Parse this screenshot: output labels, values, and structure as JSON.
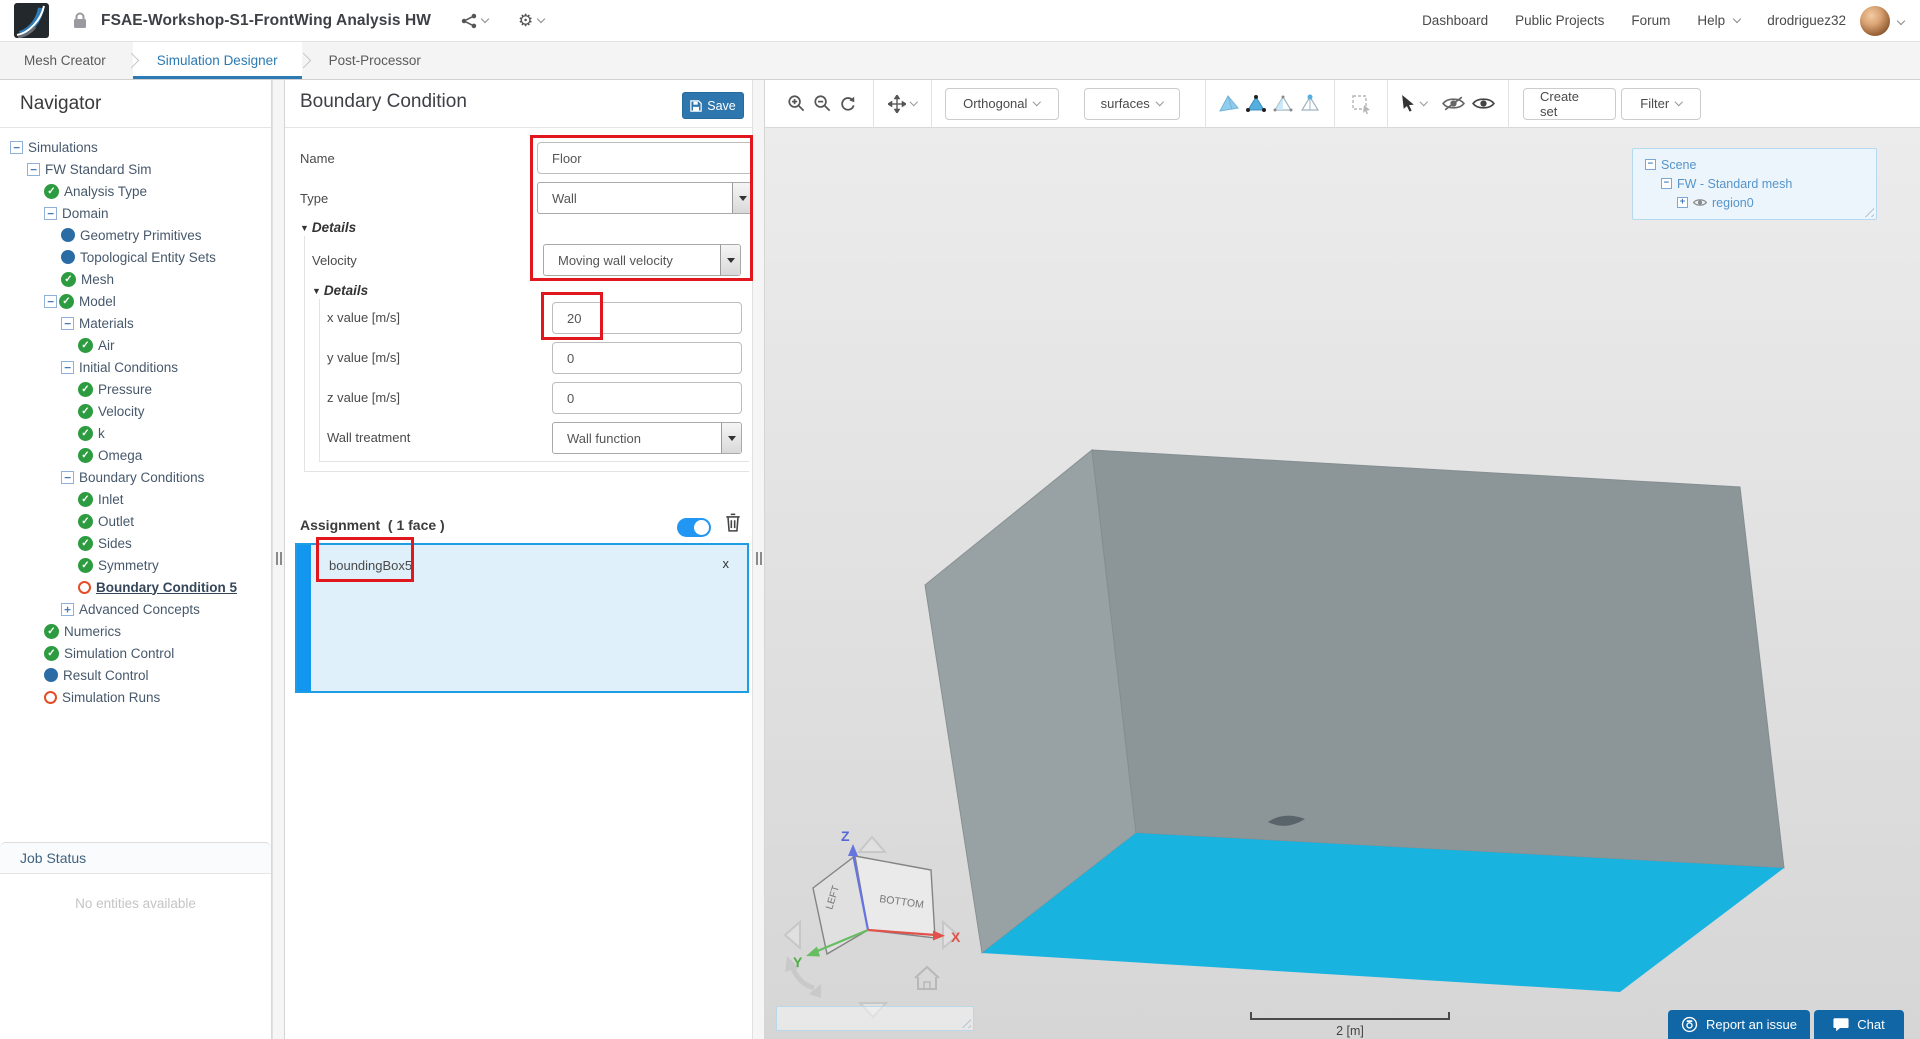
{
  "colors": {
    "accent_blue": "#2e77ae",
    "selection_blue": "#1e9de5",
    "assignment_stripe_blue": "#1296f0",
    "highlight_cyan": "#18b3df",
    "annotation_red": "#e0181e",
    "status_green": "#2d9b3f",
    "status_dot_blue": "#2c6ca5",
    "status_ring_orange": "#e44d26"
  },
  "topbar": {
    "title": "FSAE-Workshop-S1-FrontWing Analysis HW",
    "links": [
      "Dashboard",
      "Public Projects",
      "Forum",
      "Help",
      "drodriguez32"
    ]
  },
  "tabs": [
    {
      "label": "Mesh Creator",
      "active": false
    },
    {
      "label": "Simulation Designer",
      "active": true
    },
    {
      "label": "Post-Processor",
      "active": false
    }
  ],
  "navigator": {
    "title": "Navigator",
    "items": [
      {
        "label": "Simulations",
        "level": 0,
        "icon": "collapse"
      },
      {
        "label": "FW Standard Sim",
        "level": 1,
        "icon": "collapse"
      },
      {
        "label": "Analysis Type",
        "level": 2,
        "icon": "check"
      },
      {
        "label": "Domain",
        "level": 2,
        "icon": "collapse"
      },
      {
        "label": "Geometry Primitives",
        "level": 3,
        "icon": "dot"
      },
      {
        "label": "Topological Entity Sets",
        "level": 3,
        "icon": "dot"
      },
      {
        "label": "Mesh",
        "level": 3,
        "icon": "check"
      },
      {
        "label": "Model",
        "level": 2,
        "icon": "collapse,check"
      },
      {
        "label": "Materials",
        "level": 3,
        "icon": "collapse"
      },
      {
        "label": "Air",
        "level": 4,
        "icon": "check"
      },
      {
        "label": "Initial Conditions",
        "level": 3,
        "icon": "collapse"
      },
      {
        "label": "Pressure",
        "level": 4,
        "icon": "check"
      },
      {
        "label": "Velocity",
        "level": 4,
        "icon": "check"
      },
      {
        "label": "k",
        "level": 4,
        "icon": "check"
      },
      {
        "label": "Omega",
        "level": 4,
        "icon": "check"
      },
      {
        "label": "Boundary Conditions",
        "level": 3,
        "icon": "collapse"
      },
      {
        "label": "Inlet",
        "level": 4,
        "icon": "check"
      },
      {
        "label": "Outlet",
        "level": 4,
        "icon": "check"
      },
      {
        "label": "Sides",
        "level": 4,
        "icon": "check"
      },
      {
        "label": "Symmetry",
        "level": 4,
        "icon": "check"
      },
      {
        "label": "Boundary Condition 5",
        "level": 4,
        "icon": "ring",
        "selected": true
      },
      {
        "label": "Advanced Concepts",
        "level": 3,
        "icon": "expand"
      },
      {
        "label": "Numerics",
        "level": 2,
        "icon": "check"
      },
      {
        "label": "Simulation Control",
        "level": 2,
        "icon": "check"
      },
      {
        "label": "Result Control",
        "level": 2,
        "icon": "dot"
      },
      {
        "label": "Simulation Runs",
        "level": 2,
        "icon": "ring"
      }
    ],
    "job_status": {
      "title": "Job Status",
      "empty": "No entities available"
    }
  },
  "panel": {
    "title": "Boundary Condition",
    "save_label": "Save",
    "fields": {
      "name": {
        "label": "Name",
        "value": "Floor"
      },
      "type": {
        "label": "Type",
        "value": "Wall"
      },
      "details_label": "Details",
      "velocity": {
        "label": "Velocity",
        "value": "Moving wall velocity"
      },
      "details2_label": "Details",
      "x": {
        "label": "x value [m/s]",
        "value": "20"
      },
      "y": {
        "label": "y value [m/s]",
        "value": "0"
      },
      "z": {
        "label": "z value [m/s]",
        "value": "0"
      },
      "wall_treatment": {
        "label": "Wall treatment",
        "value": "Wall function"
      }
    },
    "assignment": {
      "title": "Assignment",
      "count": "( 1 face )",
      "items": [
        {
          "name": "boundingBox5",
          "remove": "x"
        }
      ]
    }
  },
  "viewport": {
    "toolbar": {
      "projection": "Orthogonal",
      "render_mode": "surfaces",
      "create_set": "Create set",
      "filter": "Filter"
    },
    "scene_tree": {
      "root": "Scene",
      "mesh": "FW - Standard mesh",
      "region": "region0"
    },
    "cube": {
      "left": "LEFT",
      "bottom": "BOTTOM",
      "x": "X",
      "y": "Y",
      "z": "Z"
    },
    "scale_label": "2 [m]",
    "report_button": "Report an issue",
    "chat_button": "Chat"
  }
}
